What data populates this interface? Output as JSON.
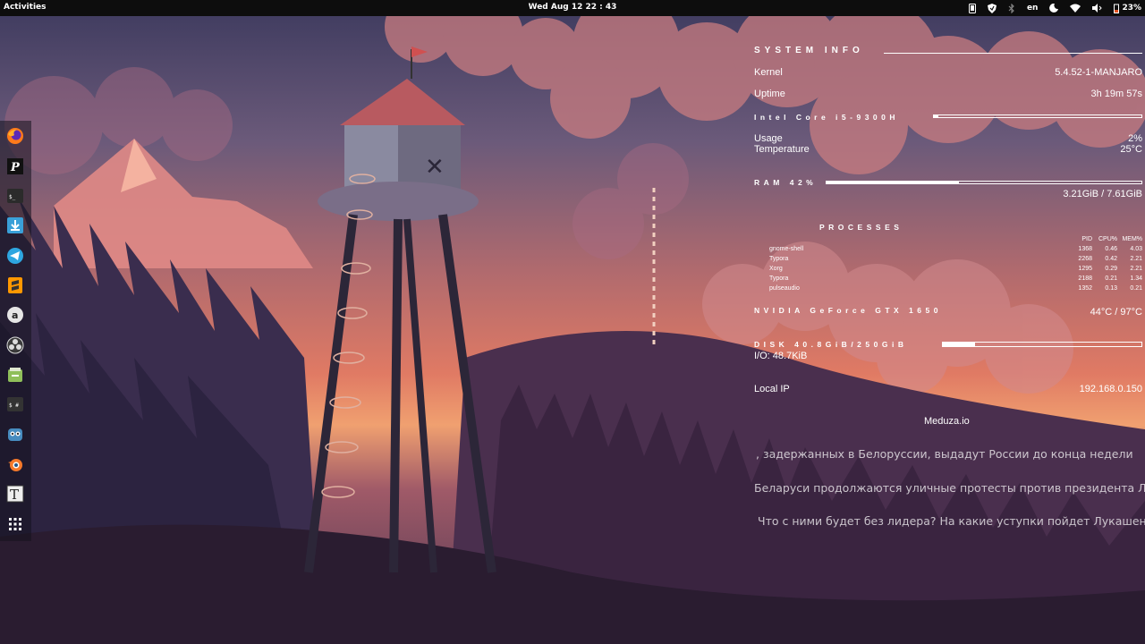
{
  "topbar": {
    "activities": "Activities",
    "clock": "Wed Aug 12  22 : 43",
    "language": "en",
    "battery": "23%"
  },
  "tray_icons": [
    "phone-icon",
    "shield-icon",
    "bluetooth-icon",
    "night-light-icon",
    "wifi-icon",
    "volume-icon",
    "battery-icon"
  ],
  "dock": {
    "apps": [
      "firefox-icon",
      "pycharm-icon",
      "terminal-icon",
      "downloader-icon",
      "telegram-icon",
      "sublime-text-icon",
      "amazon-icon",
      "obs-icon",
      "files-icon",
      "keyboard-shortcuts-icon",
      "godot-icon",
      "blender-icon",
      "typora-icon",
      "show-apps-icon"
    ],
    "labels": {
      "pycharm": "P",
      "terminal": "$_",
      "amazon": "a",
      "typora": "T",
      "shortcuts": "$ #"
    }
  },
  "conky": {
    "system_info_header": "SYSTEM INFO",
    "kernel_label": "Kernel",
    "kernel_value": "5.4.52-1-MANJARO",
    "uptime_label": "Uptime",
    "uptime_value": "3h 19m 57s",
    "cpu_header": "Intel Core i5-9300H",
    "usage_label": "Usage",
    "usage_value": "2%",
    "temp_label": "Temperature",
    "temp_value": "25°C",
    "ram_header": "RAM 42%",
    "ram_fraction": 0.42,
    "ram_value": "3.21GiB / 7.61GiB",
    "processes_header": "PROCESSES",
    "process_columns": [
      "PID",
      "CPU%",
      "MEM%"
    ],
    "processes": [
      {
        "name": "gnome-shell",
        "pid": "1368",
        "cpu": "0.46",
        "mem": "4.03"
      },
      {
        "name": "Typora",
        "pid": "2268",
        "cpu": "0.42",
        "mem": "2.21"
      },
      {
        "name": "Xorg",
        "pid": "1295",
        "cpu": "0.29",
        "mem": "2.21"
      },
      {
        "name": "Typora",
        "pid": "2188",
        "cpu": "0.21",
        "mem": "1.34"
      },
      {
        "name": "pulseaudio",
        "pid": "1352",
        "cpu": "0.13",
        "mem": "0.21"
      }
    ],
    "gpu_header": "NVIDIA GeForce GTX 1650",
    "gpu_temps": "44°C / 97°C",
    "disk_header": "DISK 40.8GiB/250GiB",
    "disk_fraction": 0.16,
    "disk_io": "I/O: 48.7KiB",
    "ip_label": "Local IP",
    "ip_value": "192.168.0.150",
    "news_source": "Meduza.io",
    "news": [
      ", задержанных в Белоруссии, выдадут России до конца недели",
      "Беларуси продолжаются уличные протесты против президента Лу",
      "Что с ними будет без лидера? На какие уступки пойдет Лукашенко"
    ]
  }
}
